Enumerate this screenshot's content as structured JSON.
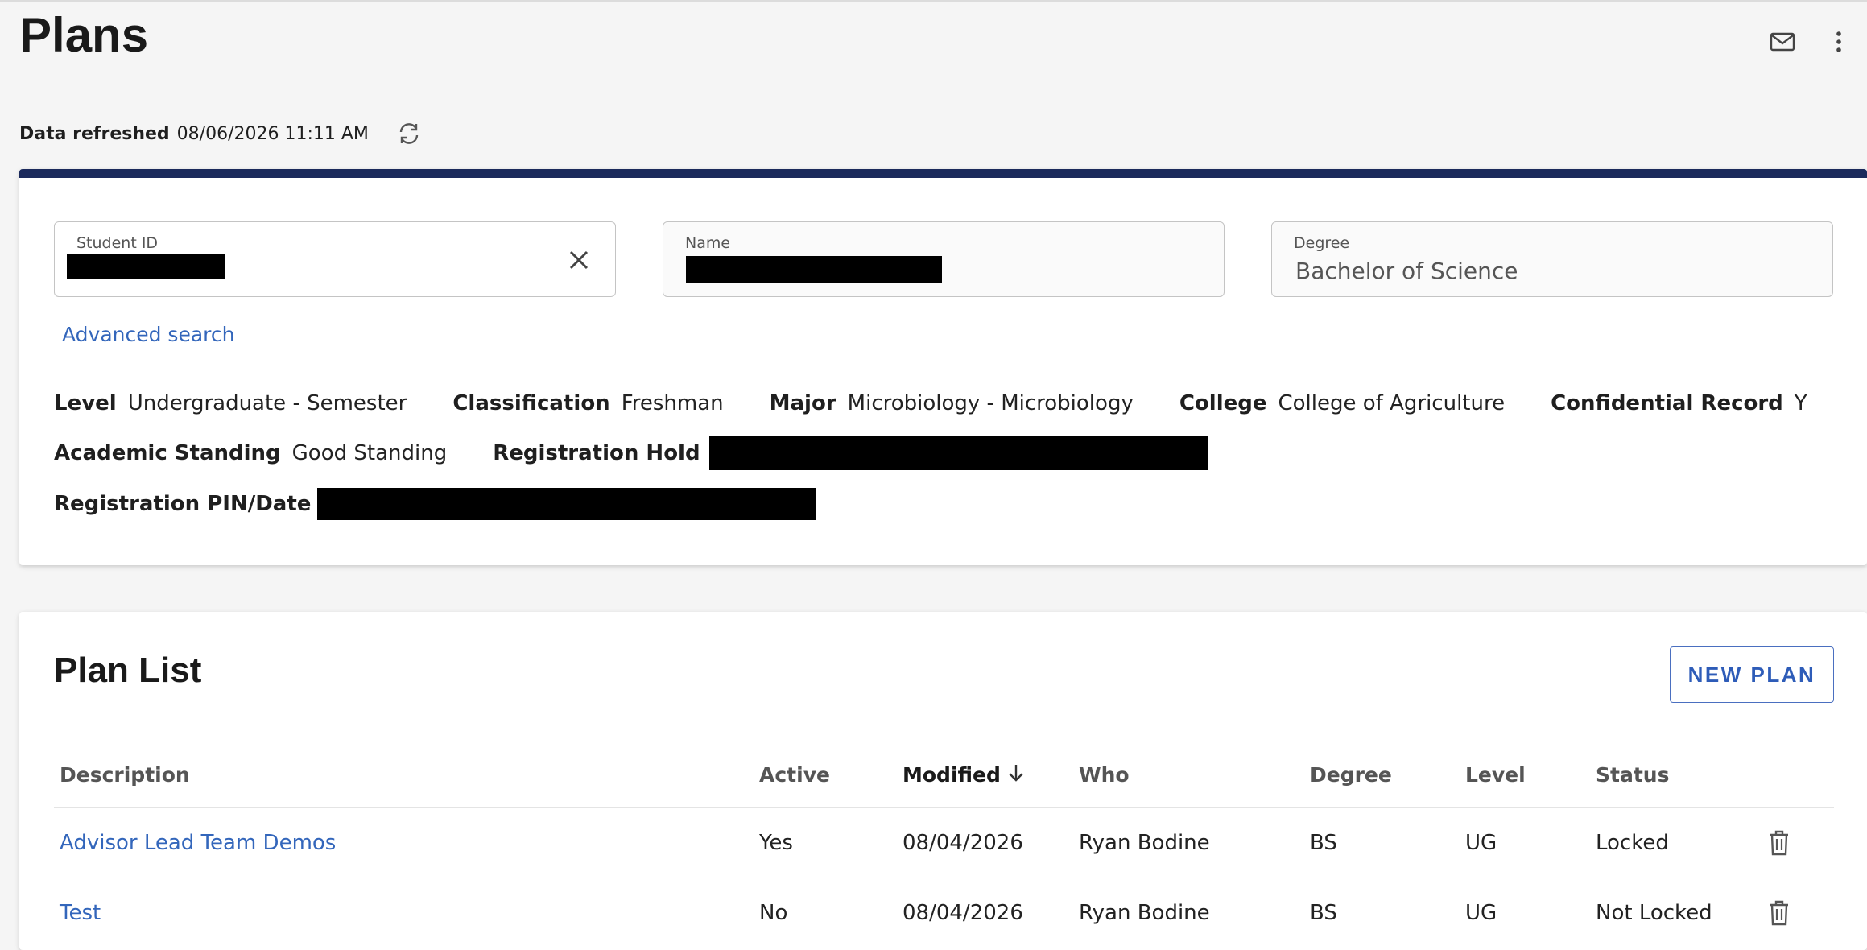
{
  "header": {
    "title": "Plans",
    "icons": [
      "mail-icon",
      "more-vertical-icon"
    ]
  },
  "refresh": {
    "label": "Data refreshed",
    "timestamp": "08/06/2026 11:11 AM"
  },
  "student": {
    "student_id_label": "Student ID",
    "name_label": "Name",
    "degree_label": "Degree",
    "degree_value": "Bachelor of Science",
    "advanced_search": "Advanced search",
    "level_label": "Level",
    "level_value": "Undergraduate - Semester",
    "classification_label": "Classification",
    "classification_value": "Freshman",
    "major_label": "Major",
    "major_value": "Microbiology - Microbiology",
    "college_label": "College",
    "college_value": "College of Agriculture",
    "confidential_label": "Confidential Record",
    "confidential_value": "Y",
    "standing_label": "Academic Standing",
    "standing_value": "Good Standing",
    "hold_label": "Registration Hold",
    "pin_label": "Registration PIN/Date"
  },
  "plans": {
    "title": "Plan List",
    "new_plan": "NEW PLAN",
    "columns": {
      "description": "Description",
      "active": "Active",
      "modified": "Modified",
      "who": "Who",
      "degree": "Degree",
      "level": "Level",
      "status": "Status"
    },
    "rows": [
      {
        "description": "Advisor Lead Team Demos",
        "active": "Yes",
        "modified": "08/04/2026",
        "who": "Ryan Bodine",
        "degree": "BS",
        "level": "UG",
        "status": "Locked"
      },
      {
        "description": "Test",
        "active": "No",
        "modified": "08/04/2026",
        "who": "Ryan Bodine",
        "degree": "BS",
        "level": "UG",
        "status": "Not Locked"
      }
    ]
  },
  "colors": {
    "accent_bar": "#1b2a5c",
    "link": "#3366bb",
    "button_text": "#2e5cb8"
  }
}
